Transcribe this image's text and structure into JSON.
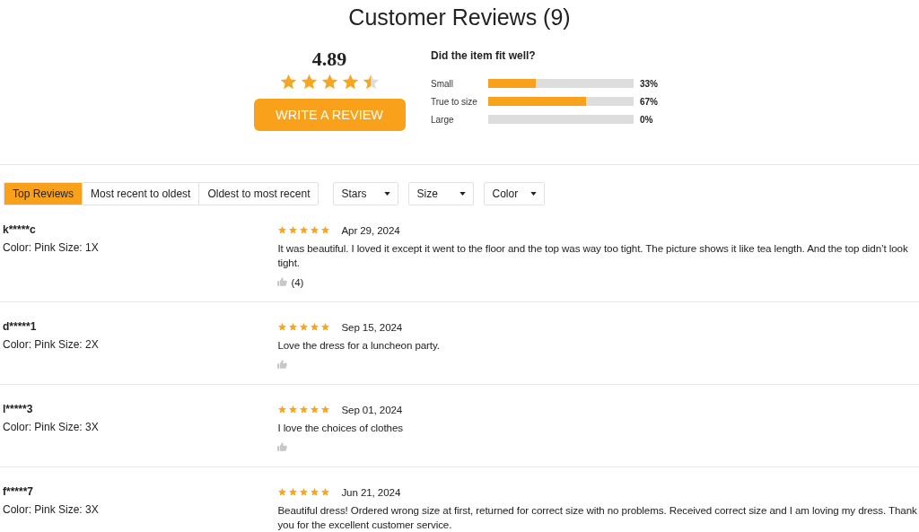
{
  "title": "Customer Reviews (9)",
  "summary": {
    "rating": "4.89",
    "stars": 4.5,
    "button": "WRITE A REVIEW"
  },
  "fit": {
    "question": "Did the item fit well?",
    "options": [
      {
        "label": "Small",
        "level": 0.33,
        "percent": "33%"
      },
      {
        "label": "True to size",
        "level": 0.67,
        "percent": "67%"
      },
      {
        "label": "Large",
        "level": 0,
        "percent": "0%"
      }
    ]
  },
  "sort_tabs": [
    {
      "label": "Top Reviews",
      "selected": true
    },
    {
      "label": "Most recent to oldest",
      "selected": false
    },
    {
      "label": "Oldest to most recent",
      "selected": false
    }
  ],
  "filters": [
    "Stars",
    "Size",
    "Color"
  ],
  "reviews": [
    {
      "user": "k*****c",
      "details": "Color: Pink Size: 1X",
      "stars": 5,
      "date": "Apr 29, 2024",
      "text": "It was beautiful. I loved it except it went to the floor and the top was way too tight. The picture shows it like tea length. And the top didn’t look tight.",
      "thumb": true,
      "likes": "(4)"
    },
    {
      "user": "d*****1",
      "details": "Color: Pink Size: 2X",
      "stars": 5,
      "date": "Sep 15, 2024",
      "text": "Love the dress for a luncheon party.",
      "thumb": true
    },
    {
      "user": "l*****3",
      "details": "Color: Pink Size: 3X",
      "stars": 5,
      "date": "Sep 01, 2024",
      "text": "I love the choices of clothes",
      "thumb": true
    },
    {
      "user": "f*****7",
      "details": "Color: Pink Size: 3X",
      "stars": 5,
      "date": "Jun 21, 2024",
      "text": "Beautiful dress! Ordered wrong size at first, returned for correct size with no problems. Received correct size and I am loving my dress. Thank you for the excellent customer service.",
      "thumb": false
    }
  ]
}
